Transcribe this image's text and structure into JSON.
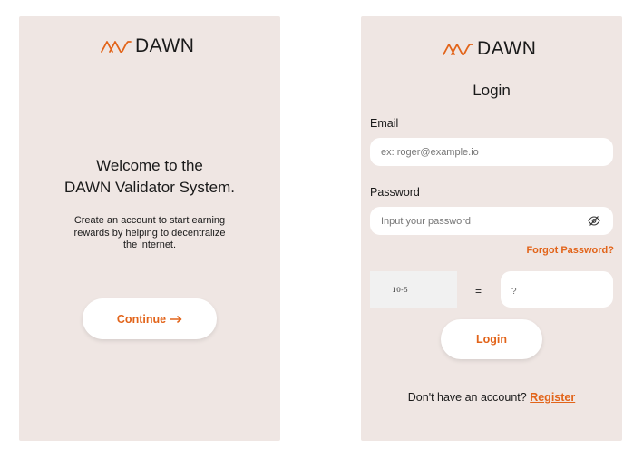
{
  "brand": {
    "name": "DAWN",
    "accent_color": "#e2641a",
    "panel_background": "#efe6e3"
  },
  "welcome": {
    "title_line1": "Welcome to the",
    "title_line2": "DAWN Validator System.",
    "subtitle_line1": "Create an account to start earning",
    "subtitle_line2": "rewards by helping to decentralize",
    "subtitle_line3": "the internet.",
    "continue_label": "Continue",
    "continue_icon": "arrow-right-icon"
  },
  "login": {
    "title": "Login",
    "email_label": "Email",
    "email_placeholder": "ex: roger@example.io",
    "email_value": "",
    "password_label": "Password",
    "password_placeholder": "Input your password",
    "password_value": "",
    "password_toggle_icon": "eye-slash-icon",
    "forgot_password": "Forgot Password?",
    "captcha_text": "10-5",
    "equals": "=",
    "captcha_answer_placeholder": "?",
    "captcha_answer_value": "",
    "login_button": "Login",
    "register_prompt": "Don't have an account?",
    "register_link": "Register"
  }
}
